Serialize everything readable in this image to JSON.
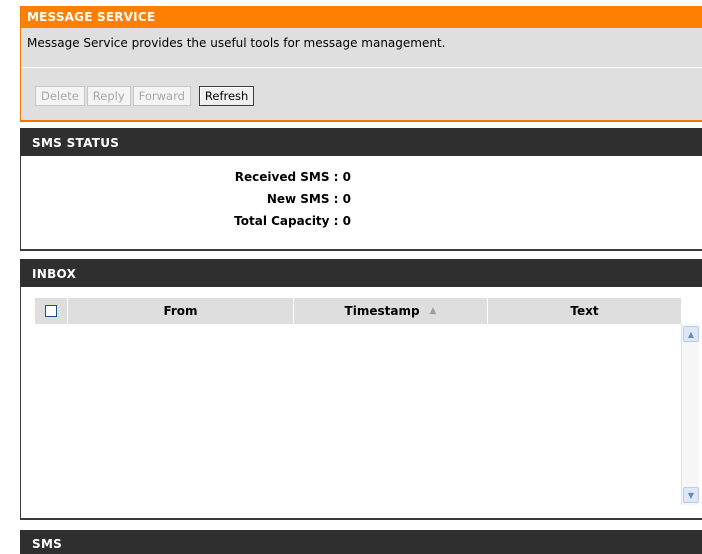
{
  "message_service": {
    "title": "MESSAGE SERVICE",
    "description": "Message Service provides the useful tools for message management.",
    "buttons": {
      "delete": "Delete",
      "reply": "Reply",
      "forward": "Forward",
      "refresh": "Refresh"
    }
  },
  "sms_status": {
    "title": "SMS STATUS",
    "received": "Received SMS : 0",
    "new": "New SMS : 0",
    "capacity": "Total Capacity : 0"
  },
  "inbox": {
    "title": "INBOX",
    "columns": [
      "From",
      "Timestamp",
      "Text"
    ],
    "sort_indicator": "▲",
    "rows": []
  },
  "sms": {
    "title": "SMS"
  },
  "colors": {
    "accent": "#ff7f00",
    "section_header": "#2f2f2f",
    "panel_bg": "#dfdfdf"
  },
  "icons": {
    "scroll_up": "chevron-up-icon",
    "scroll_down": "chevron-down-icon",
    "sort": "sort-ascending-icon"
  }
}
